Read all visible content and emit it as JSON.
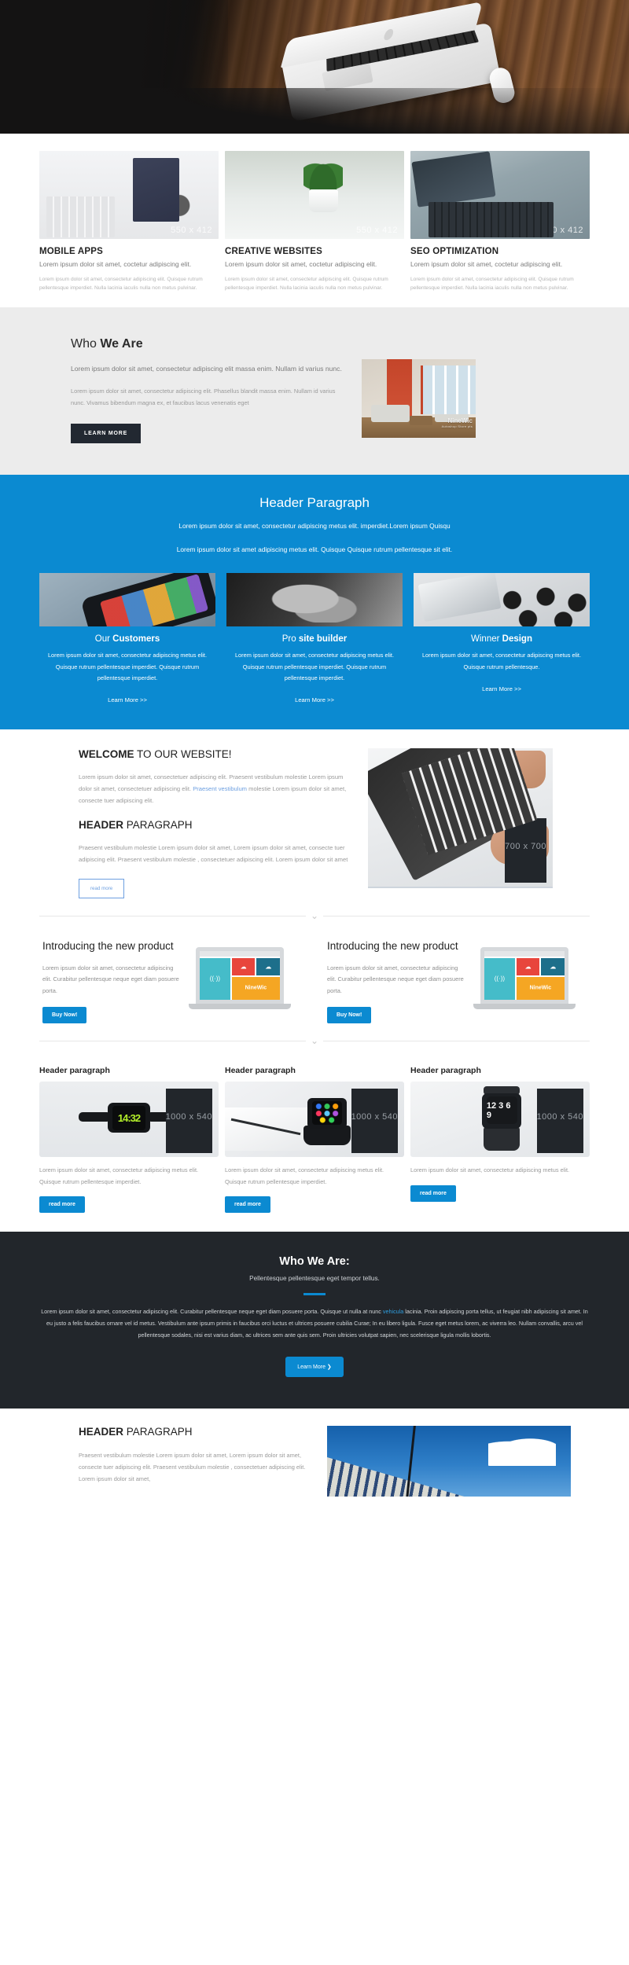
{
  "hero": {
    "alt": "laptop-and-mouse-on-wooden-desk"
  },
  "services": {
    "items": [
      {
        "image_placeholder": "550 x 412",
        "title": "MOBILE APPS",
        "lead": "Lorem ipsum dolor sit amet, coctetur adipiscing elit.",
        "body": "Lorem ipsum dolor sit amet, consectetur adipiscing elit. Quisque rutrum pellentesque imperdiet. Nulla lacinia iaculis nulla non metus pulvinar."
      },
      {
        "image_placeholder": "550 x 412",
        "title": "CREATIVE WEBSITES",
        "lead": "Lorem ipsum dolor sit amet, coctetur adipiscing elit.",
        "body": "Lorem ipsum dolor sit amet, consectetur adipiscing elit. Quisque rutrum pellentesque imperdiet. Nulla lacinia iaculis nulla non metus pulvinar."
      },
      {
        "image_placeholder": "550 x 412",
        "title": "SEO OPTIMIZATION",
        "lead": "Lorem ipsum dolor sit amet, coctetur adipiscing elit.",
        "body": "Lorem ipsum dolor sit amet, consectetur adipiscing elit. Quisque rutrum pellentesque imperdiet. Nulla lacinia iaculis nulla non metus pulvinar."
      }
    ]
  },
  "who_we_are": {
    "heading_light": "Who ",
    "heading_bold": "We Are",
    "lead": "Lorem ipsum dolor sit amet, consectetur adipiscing elit massa enim. Nullam id varius nunc.",
    "body": "Lorem ipsum dolor sit amet, consectetur adipiscing elit. Phasellus blandit massa enim. Nullam id varius nunc. Vivamus bibendum magna ex, et faucibus lacus venenatis eget",
    "button": "LEARN MORE",
    "image_watermark": "NineWic",
    "image_watermark_sub": "Autoshop Store pts",
    "bg_color": "#ececec"
  },
  "blue_section": {
    "bg_color": "#0b8ad1",
    "heading": "Header Paragraph",
    "sub1": "Lorem ipsum dolor sit amet, consectetur adipiscing metus elit. imperdiet.Lorem ipsum Quisqu",
    "sub2": "Lorem ipsum dolor sit amet adipiscing metus elit. Quisque Quisque rutrum pellentesque sit elit.",
    "columns": [
      {
        "title_light": "Our ",
        "title_bold": "Customers",
        "body": "Lorem ipsum dolor sit amet, consectetur adipiscing metus elit. Quisque rutrum pellentesque imperdiet. Quisque rutrum pellentesque imperdiet.",
        "link": "Learn More >>"
      },
      {
        "title_light": "Pro ",
        "title_bold": "site builder",
        "body": "Lorem ipsum dolor sit amet, consectetur adipiscing metus elit. Quisque rutrum pellentesque imperdiet. Quisque rutrum pellentesque imperdiet.",
        "link": "Learn More >>"
      },
      {
        "title_light": "Winner ",
        "title_bold": "Design",
        "body": "Lorem ipsum dolor sit amet, consectetur adipiscing metus elit. Quisque rutrum pellentesque.",
        "link": "Learn More >>"
      }
    ]
  },
  "welcome": {
    "heading_bold": "WELCOME",
    "heading_light": " TO OUR WEBSITE!",
    "paragraph_a": "Lorem ipsum dolor sit amet, consectetuer adipiscing elit. Praesent vestibulum molestie Lorem ipsum dolor sit amet, consectetuer adipiscing elit. ",
    "paragraph_a_link": "Praesent vestibulum",
    "paragraph_a_tail": " molestie Lorem ipsum dolor sit amet, consecte tuer adipiscing elit.",
    "subheading_bold": "HEADER",
    "subheading_light": " PARAGRAPH",
    "paragraph_b": "Praesent vestibulum molestie Lorem ipsum dolor sit amet, Lorem ipsum dolor sit amet, consecte tuer adipiscing elit. Praesent vestibulum molestie , consectetuer adipiscing elit. Lorem ipsum dolor sit amet",
    "button": "read more",
    "image_placeholder": "700 x 700"
  },
  "product": {
    "items": [
      {
        "heading": "Introducing the new product",
        "body": "Lorem ipsum dolor sit amet, consectetur adipiscing elit. Curabitur pellentesque neque eget diam posuere porta.",
        "button": "Buy Now!",
        "illustration_brand": "NineWic"
      },
      {
        "heading": "Introducing the new product",
        "body": "Lorem ipsum dolor sit amet, consectetur adipiscing elit. Curabitur pellentesque neque eget diam posuere porta.",
        "button": "Buy Now!",
        "illustration_brand": "NineWic"
      }
    ]
  },
  "cards": {
    "items": [
      {
        "title": "Header paragraph",
        "image_placeholder": "1000 x 540",
        "body": "Lorem ipsum dolor sit amet, consectetur adipiscing metus elit. Quisque rutrum pellentesque imperdiet.",
        "button": "read more",
        "watch_face": "14:32"
      },
      {
        "title": "Header paragraph",
        "image_placeholder": "1000 x 540",
        "body": "Lorem ipsum dolor sit amet, consectetur adipiscing metus elit. Quisque rutrum pellentesque imperdiet.",
        "button": "read more",
        "watch_face": ""
      },
      {
        "title": "Header paragraph",
        "image_placeholder": "1000 x 540",
        "body": "Lorem ipsum dolor sit amet, consectetur adipiscing metus elit.",
        "button": "read more",
        "watch_face": "12 3 6 9"
      }
    ]
  },
  "dark_section": {
    "bg_color": "#22262b",
    "accent_color": "#0b8ad1",
    "heading": "Who We Are:",
    "tagline": "Pellentesque pellentesque eget tempor tellus.",
    "copy_a": "Lorem ipsum dolor sit amet, consectetur adipiscing elit. Curabitur pellentesque neque eget diam posuere porta. Quisque ut nulla at nunc ",
    "copy_link": "vehicula",
    "copy_b": " lacinia. Proin adipiscing porta tellus, ut feugiat nibh adipiscing sit amet. In eu justo a felis faucibus ornare vel id metus. Vestibulum ante ipsum primis in faucibus orci luctus et ultrices posuere cubilia Curae; In eu libero ligula. Fusce eget metus lorem, ac viverra leo. Nullam convallis, arcu vel pellentesque sodales, nisi est varius diam, ac ultrices sem ante quis sem. Proin ultricies volutpat sapien, nec scelerisque ligula mollis lobortis.",
    "button": "Learn More ❯"
  },
  "footer_block": {
    "heading_bold": "HEADER",
    "heading_light": " PARAGRAPH",
    "body": "Praesent vestibulum molestie Lorem ipsum dolor sit amet, Lorem ipsum dolor sit amet, consecte tuer adipiscing elit. Praesent vestibulum molestie , consectetuer adipiscing elit.  Lorem ipsum dolor sit amet,"
  },
  "icons": {
    "chevron_down": "⌄"
  }
}
